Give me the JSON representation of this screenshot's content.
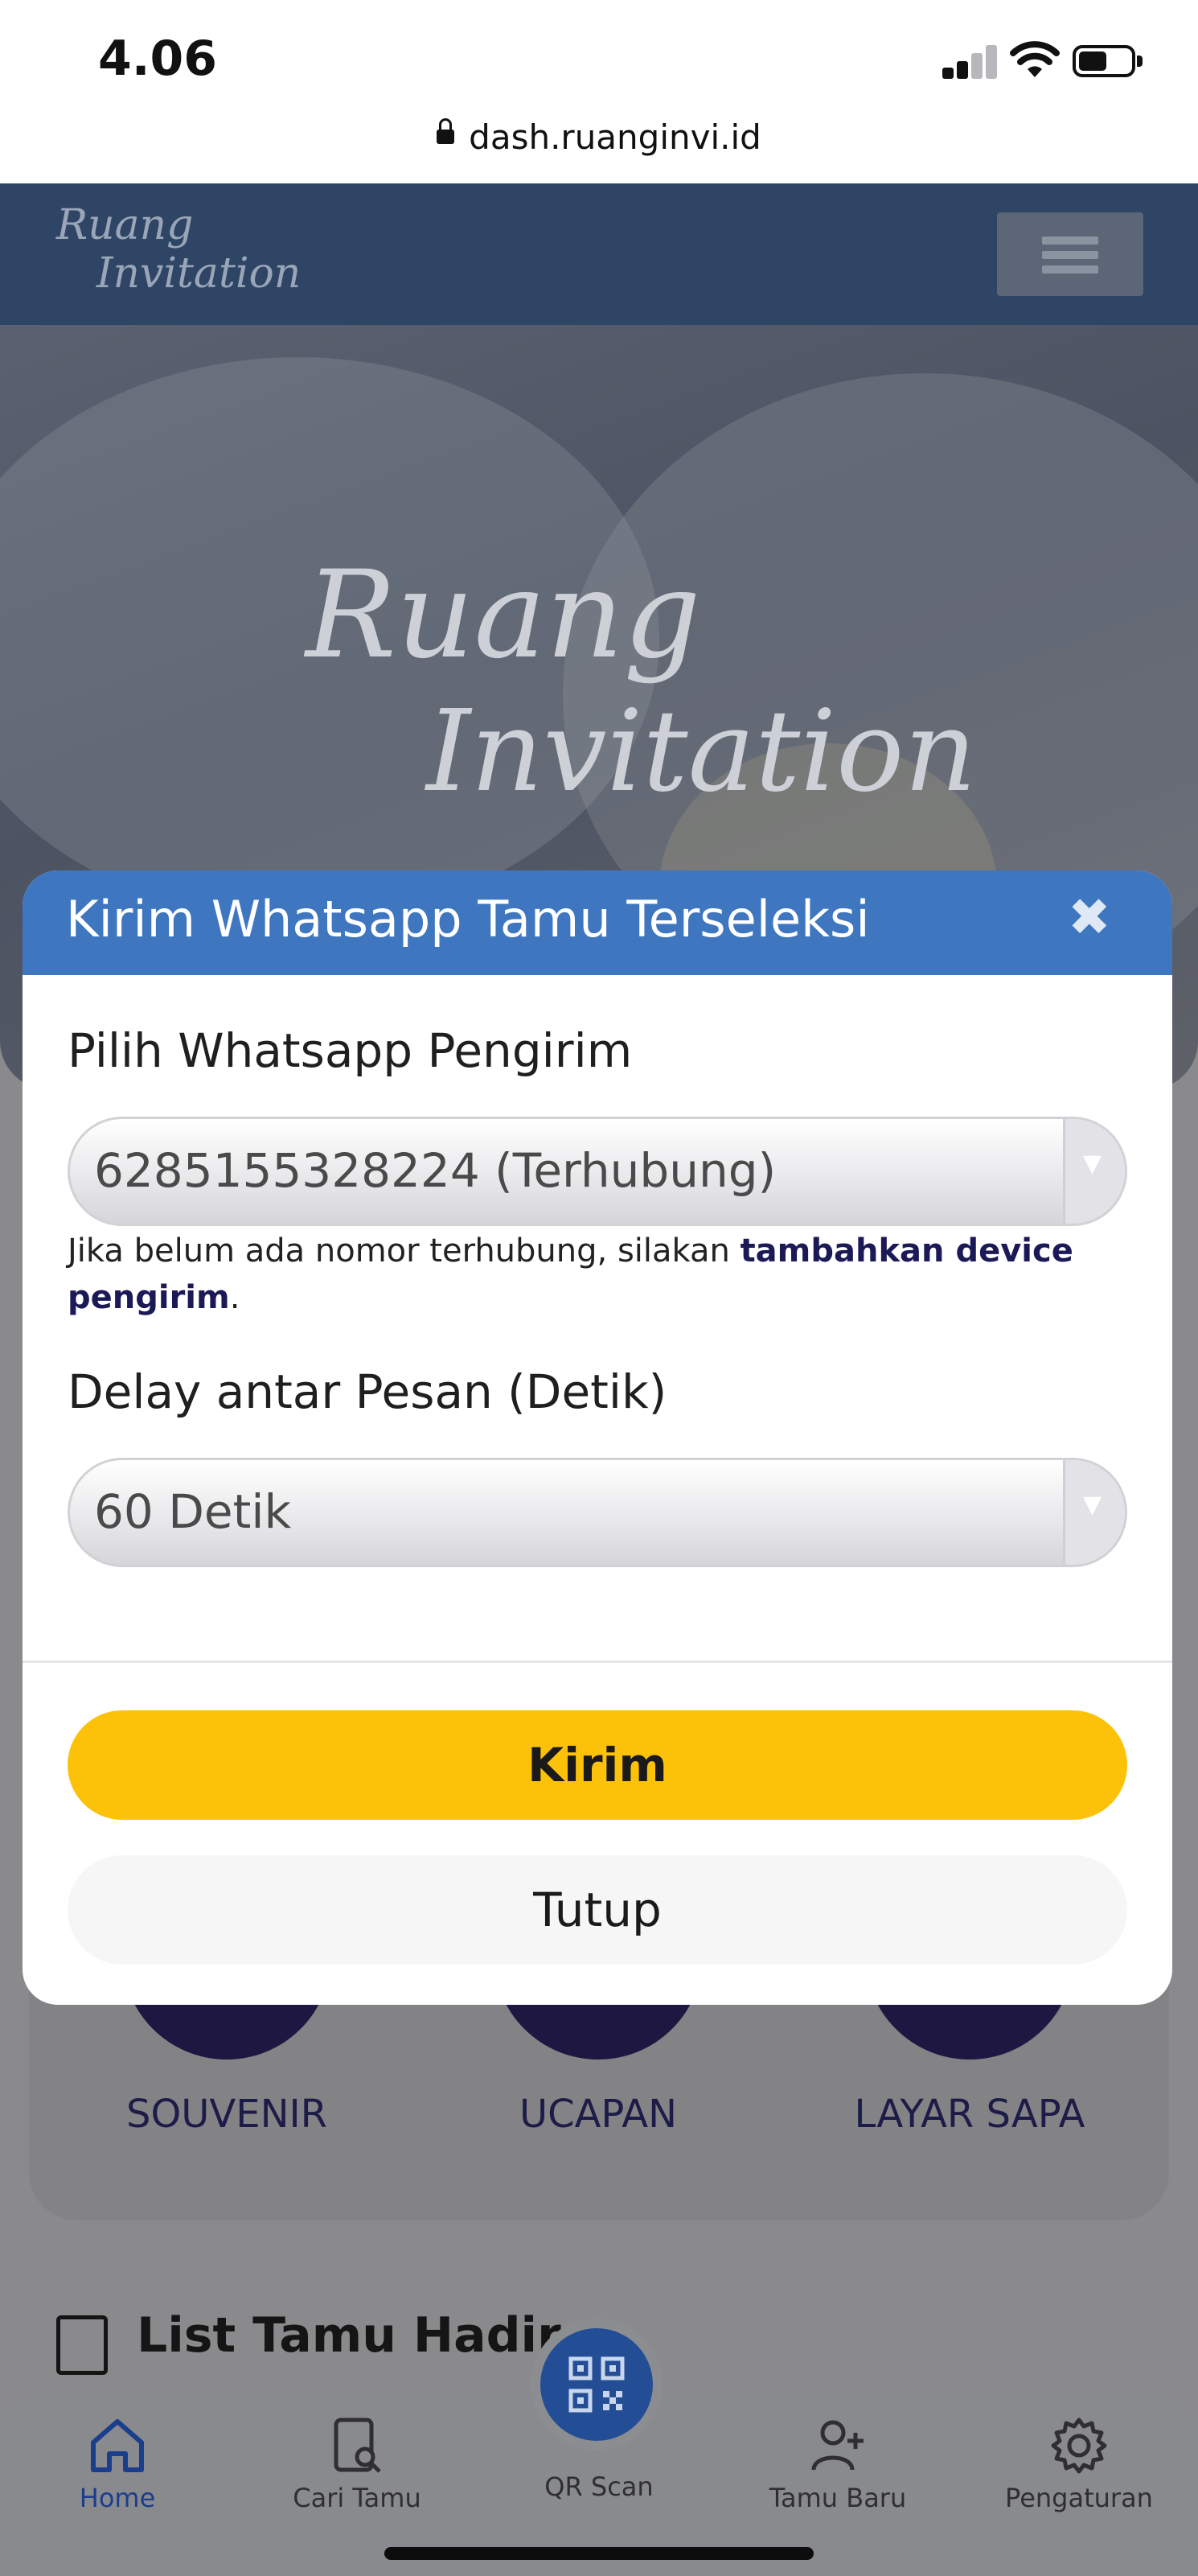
{
  "status_bar": {
    "time": "4.06",
    "url": "dash.ruanginvi.id"
  },
  "app": {
    "brand_line1": "Ruang",
    "brand_line2": "Invitation"
  },
  "hero": {
    "brand_line1": "Ruang",
    "brand_line2": "Invitation"
  },
  "menu_items": [
    "SOUVENIR",
    "UCAPAN",
    "LAYAR SAPA"
  ],
  "list_section": {
    "title": "List Tamu Hadir"
  },
  "bottom_nav": {
    "items": [
      {
        "label": "Home",
        "icon": "home-icon",
        "active": true
      },
      {
        "label": "Cari Tamu",
        "icon": "search-guest-icon"
      },
      {
        "label": "QR Scan",
        "icon": "qr-code-icon"
      },
      {
        "label": "Tamu Baru",
        "icon": "add-user-icon"
      },
      {
        "label": "Pengaturan",
        "icon": "gear-icon"
      }
    ]
  },
  "modal": {
    "title": "Kirim Whatsapp Tamu Terseleksi",
    "close_symbol": "✖",
    "sender": {
      "label": "Pilih Whatsapp Pengirim",
      "selected": "6285155328224 (Terhubung)"
    },
    "hint": {
      "prefix": "Jika belum ada nomor terhubung, silakan ",
      "link": "tambahkan device pengirim",
      "suffix": "."
    },
    "delay": {
      "label": "Delay antar Pesan (Detik)",
      "selected": "60 Detik"
    },
    "submit_label": "Kirim",
    "close_label": "Tutup"
  },
  "colors": {
    "modal_header": "#3f76c0",
    "submit_button": "#fcc20a",
    "link_text": "#1b1a57",
    "nav_active": "#1a3e8c"
  }
}
